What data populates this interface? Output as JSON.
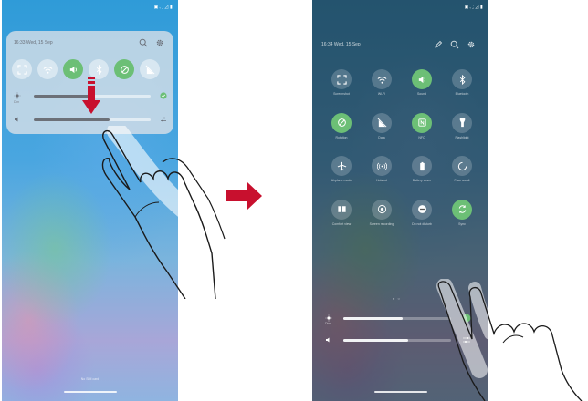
{
  "left_screen": {
    "status_bar": "▣ ⛶ ◿ ▮",
    "panel": {
      "datetime": "16:33 Wed, 15 Sep",
      "toggles": [
        {
          "icon": "screenshot-icon",
          "on": false
        },
        {
          "icon": "wifi-icon",
          "on": false
        },
        {
          "icon": "sound-icon",
          "on": true
        },
        {
          "icon": "bluetooth-icon",
          "on": false
        },
        {
          "icon": "rotation-icon",
          "on": true
        },
        {
          "icon": "data-icon",
          "on": false
        }
      ],
      "brightness_label": "Dim",
      "brightness_level": 0.5,
      "volume_level": 0.65
    },
    "bottom_hint": "No SIM card"
  },
  "right_screen": {
    "status_bar": "▣ ⛶ ◿ ▮",
    "panel": {
      "datetime": "16:34 Wed, 15 Sep",
      "tiles": [
        {
          "label": "Screenshot",
          "icon": "screenshot-icon",
          "on": false
        },
        {
          "label": "Wi-Fi",
          "icon": "wifi-icon",
          "on": false
        },
        {
          "label": "Sound",
          "icon": "sound-icon",
          "on": true
        },
        {
          "label": "Bluetooth",
          "icon": "bluetooth-icon",
          "on": false
        },
        {
          "label": "Rotation",
          "icon": "rotation-icon",
          "on": true
        },
        {
          "label": "Data",
          "icon": "data-icon",
          "on": false
        },
        {
          "label": "NFC",
          "icon": "nfc-icon",
          "on": true
        },
        {
          "label": "Flashlight",
          "icon": "flashlight-icon",
          "on": false
        },
        {
          "label": "Airplane mode",
          "icon": "airplane-icon",
          "on": false
        },
        {
          "label": "Hotspot",
          "icon": "hotspot-icon",
          "on": false
        },
        {
          "label": "Battery saver",
          "icon": "battery-icon",
          "on": false
        },
        {
          "label": "Face await",
          "icon": "face-icon",
          "on": false
        },
        {
          "label": "Comfort view",
          "icon": "book-icon",
          "on": false
        },
        {
          "label": "Screen recording",
          "icon": "record-icon",
          "on": false
        },
        {
          "label": "Do not disturb",
          "icon": "dnd-icon",
          "on": false
        },
        {
          "label": "Sync",
          "icon": "sync-icon",
          "on": true
        }
      ],
      "pager": "● ○",
      "brightness_label": "Dim",
      "brightness_level": 0.55,
      "volume_level": 0.6
    }
  },
  "colors": {
    "toggle_on": "#6cbf76",
    "arrow": "#c8102e",
    "drag_arrow": "#c8102e"
  }
}
